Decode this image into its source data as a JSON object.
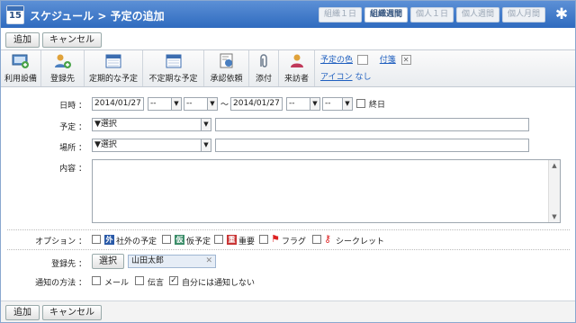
{
  "header": {
    "calendar_day": "15",
    "title": "スケジュール > 予定の追加",
    "views": [
      "組織１日",
      "組織週間",
      "個人１日",
      "個人週間",
      "個人月間"
    ],
    "active_view": "組織週間"
  },
  "actions": {
    "add": "追加",
    "cancel": "キャンセル"
  },
  "toolbar": {
    "items": [
      "利用設備",
      "登録先",
      "定期的な予定",
      "不定期な予定",
      "承認依頼",
      "添付",
      "来訪者"
    ],
    "color_link": "予定の色",
    "tag_link": "付箋",
    "icon_link": "アイコン",
    "icon_value": "なし"
  },
  "form": {
    "datetime_label": "日時",
    "start_date": "2014/01/27",
    "end_date": "2014/01/27",
    "dash": "--",
    "tilde": "〜",
    "allday_label": "終日",
    "plan_label": "予定",
    "plan_select": "▼選択",
    "place_label": "場所",
    "place_select": "▼選択",
    "content_label": "内容",
    "colon": "：",
    "options_label": "オプション",
    "options": [
      "社外の予定",
      "仮予定",
      "重要",
      "フラグ",
      "シークレット"
    ],
    "option_icons": [
      "外",
      "仮",
      "重"
    ],
    "registrant_label": "登録先",
    "select_button": "選択",
    "registrant_name": "山田太郎",
    "notify_label": "通知の方法",
    "notify_options": [
      "メール",
      "伝言",
      "自分には通知しない"
    ]
  },
  "colors": {
    "header": "#2f6bbf",
    "link": "#1f5fbf"
  }
}
